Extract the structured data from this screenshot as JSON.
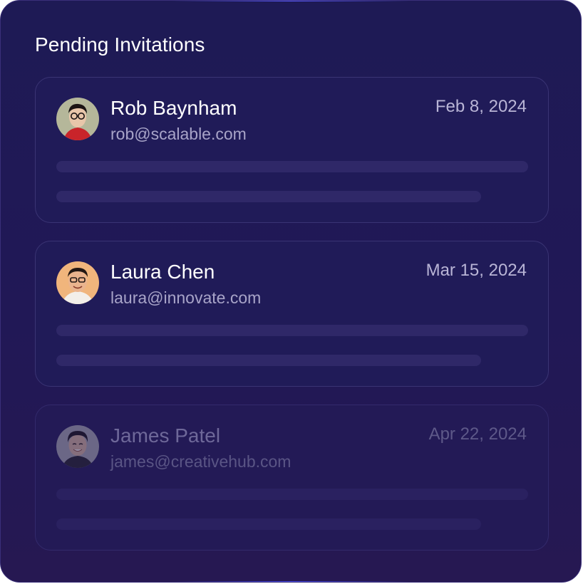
{
  "header": {
    "title": "Pending Invitations"
  },
  "invitations": [
    {
      "name": "Rob Baynham",
      "email": "rob@scalable.com",
      "date": "Feb 8, 2024",
      "status": "active"
    },
    {
      "name": "Laura Chen",
      "email": "laura@innovate.com",
      "date": "Mar 15, 2024",
      "status": "active"
    },
    {
      "name": "James Patel",
      "email": "james@creativehub.com",
      "date": "Apr 22, 2024",
      "status": "faded"
    }
  ],
  "colors": {
    "panel_background": "#1e1a55",
    "card_background": "#201b58",
    "card_border": "#3a3474",
    "placeholder_bar": "#2f2868",
    "name_text": "#ffffff",
    "email_text": "#a8a4c8",
    "date_text": "#b9b5d6"
  }
}
